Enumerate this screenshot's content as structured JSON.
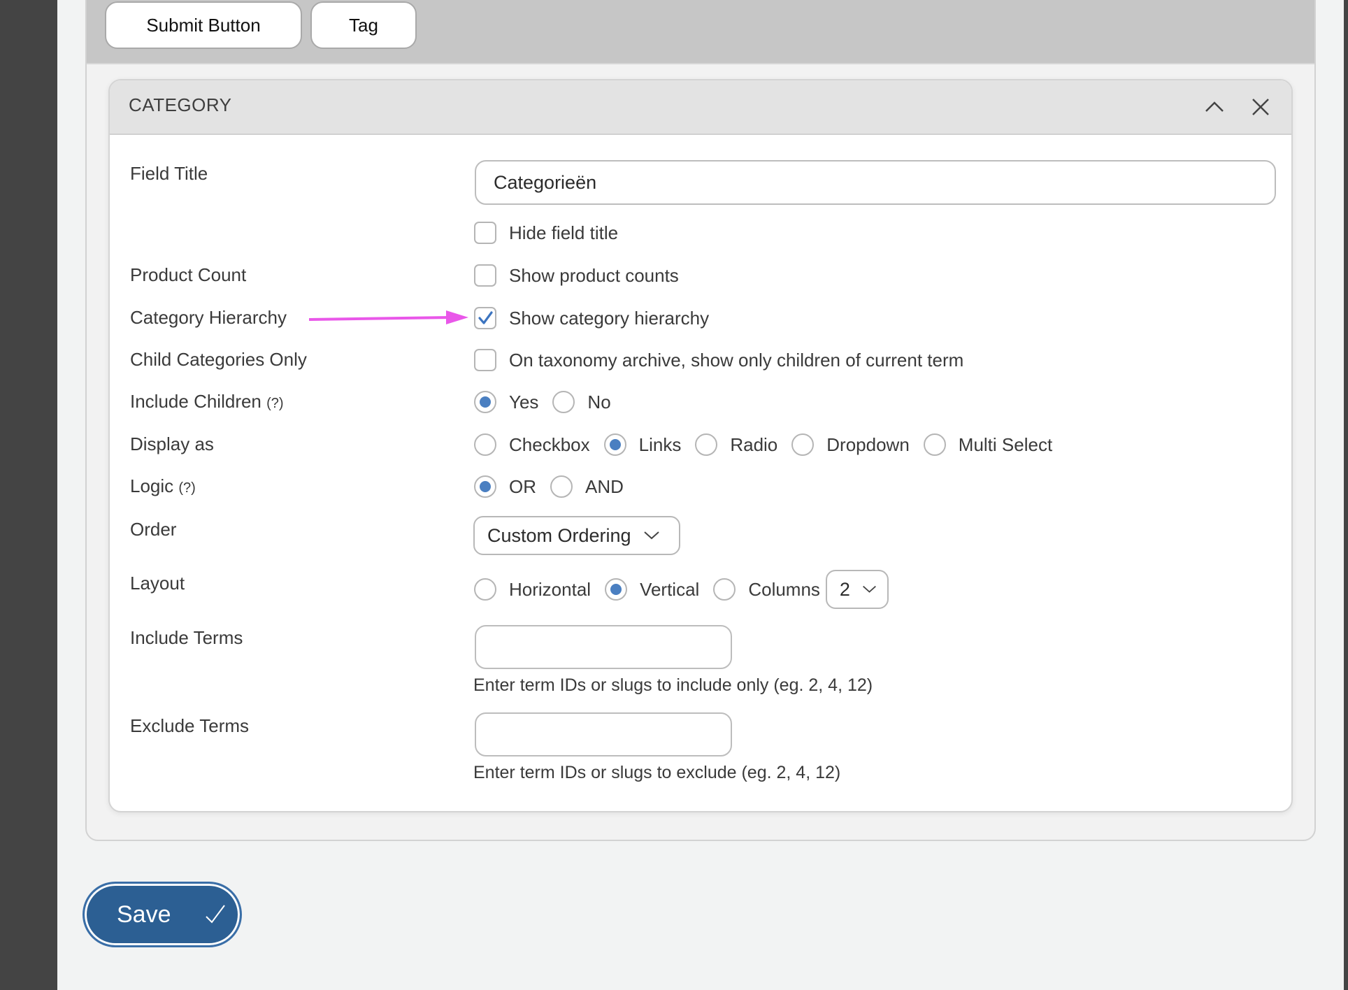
{
  "tabs": [
    {
      "label": "Submit Button"
    },
    {
      "label": "Tag"
    }
  ],
  "panel": {
    "title": "CATEGORY",
    "icons": [
      "chevron-up-icon",
      "close-icon"
    ]
  },
  "fields": {
    "field_title": {
      "label": "Field Title",
      "value": "Categorieën"
    },
    "hide_title": {
      "label": "Hide field title",
      "checked": false
    },
    "product_count": {
      "label": "Product Count",
      "option": "Show product counts",
      "checked": false
    },
    "category_hierarchy": {
      "label": "Category Hierarchy",
      "option": "Show category hierarchy",
      "checked": true
    },
    "child_only": {
      "label": "Child Categories Only",
      "option": "On taxonomy archive, show only children of current term",
      "checked": false
    },
    "include_children": {
      "label": "Include Children",
      "help": "(?)",
      "options": [
        "Yes",
        "No"
      ],
      "selected": "Yes"
    },
    "display_as": {
      "label": "Display as",
      "options": [
        "Checkbox",
        "Links",
        "Radio",
        "Dropdown",
        "Multi Select"
      ],
      "selected": "Links"
    },
    "logic": {
      "label": "Logic",
      "help": "(?)",
      "options": [
        "OR",
        "AND"
      ],
      "selected": "OR"
    },
    "order": {
      "label": "Order",
      "selected": "Custom Ordering"
    },
    "layout": {
      "label": "Layout",
      "options": [
        "Horizontal",
        "Vertical",
        "Columns"
      ],
      "selected": "Vertical",
      "columns_value": "2"
    },
    "include_terms": {
      "label": "Include Terms",
      "value": "",
      "hint": "Enter term IDs or slugs to include only (eg. 2, 4, 12)"
    },
    "exclude_terms": {
      "label": "Exclude Terms",
      "value": "",
      "hint": "Enter term IDs or slugs to exclude (eg. 2, 4, 12)"
    }
  },
  "annotation": {
    "type": "arrow",
    "color": "#e957e9",
    "points_to": "Show category hierarchy"
  },
  "colors": {
    "accent": "#4a7fc1",
    "save": "#2c5f93"
  },
  "save_button": {
    "label": "Save"
  }
}
